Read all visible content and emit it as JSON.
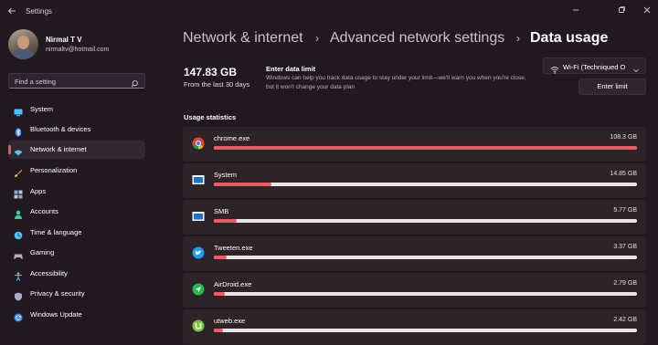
{
  "window": {
    "title": "Settings",
    "back_icon": "back-arrow-icon",
    "controls": [
      "minimize-icon",
      "maximize-icon",
      "close-icon"
    ]
  },
  "user": {
    "name": "Nirmal T V",
    "email": "nirmaltv@hotmail.com"
  },
  "search": {
    "placeholder": "Find a setting"
  },
  "sidebar": {
    "items": [
      {
        "label": "System",
        "icon": "monitor-icon",
        "color": "#4cc2ff"
      },
      {
        "label": "Bluetooth & devices",
        "icon": "bluetooth-icon",
        "color": "#3a8ef6"
      },
      {
        "label": "Network & internet",
        "icon": "wifi-network-icon",
        "color": "#4cc2ff",
        "active": true
      },
      {
        "label": "Personalization",
        "icon": "brush-icon",
        "color": "#e8a060"
      },
      {
        "label": "Apps",
        "icon": "apps-grid-icon",
        "color": "#8fa8c8"
      },
      {
        "label": "Accounts",
        "icon": "person-icon",
        "color": "#3fc7a8"
      },
      {
        "label": "Time & language",
        "icon": "globe-clock-icon",
        "color": "#4cc2ff"
      },
      {
        "label": "Gaming",
        "icon": "gamepad-icon",
        "color": "#b8b0b6"
      },
      {
        "label": "Accessibility",
        "icon": "accessibility-icon",
        "color": "#4cc2ff"
      },
      {
        "label": "Privacy & security",
        "icon": "shield-icon",
        "color": "#a8b0c0"
      },
      {
        "label": "Windows Update",
        "icon": "update-icon",
        "color": "#3a8ef6"
      }
    ]
  },
  "breadcrumb": {
    "items": [
      "Network & internet",
      "Advanced network settings",
      "Data usage"
    ],
    "separator": "›"
  },
  "summary": {
    "total": "147.83 GB",
    "period": "From the last 30 days",
    "limit_title": "Enter data limit",
    "limit_desc": "Windows can help you track data usage to stay under your limit—we'll warn you when you're close, but it won't change your data plan",
    "network_selected": "Wi-Fi (Techniqued O",
    "limit_button": "Enter limit"
  },
  "usage": {
    "heading": "Usage statistics",
    "accent": "#ef5a5f",
    "apps": [
      {
        "name": "chrome.exe",
        "amount": "108.3 GB",
        "fraction": 1.0,
        "icon": "chrome-icon"
      },
      {
        "name": "System",
        "amount": "14.85 GB",
        "fraction": 0.137,
        "icon": "system-window-icon"
      },
      {
        "name": "SMB",
        "amount": "5.77 GB",
        "fraction": 0.053,
        "icon": "smb-window-icon"
      },
      {
        "name": "Tweeten.exe",
        "amount": "3.37 GB",
        "fraction": 0.031,
        "icon": "tweeten-bird-icon"
      },
      {
        "name": "AirDroid.exe",
        "amount": "2.79 GB",
        "fraction": 0.026,
        "icon": "airdroid-icon"
      },
      {
        "name": "utweb.exe",
        "amount": "2.42 GB",
        "fraction": 0.022,
        "icon": "utorrent-icon"
      }
    ]
  }
}
